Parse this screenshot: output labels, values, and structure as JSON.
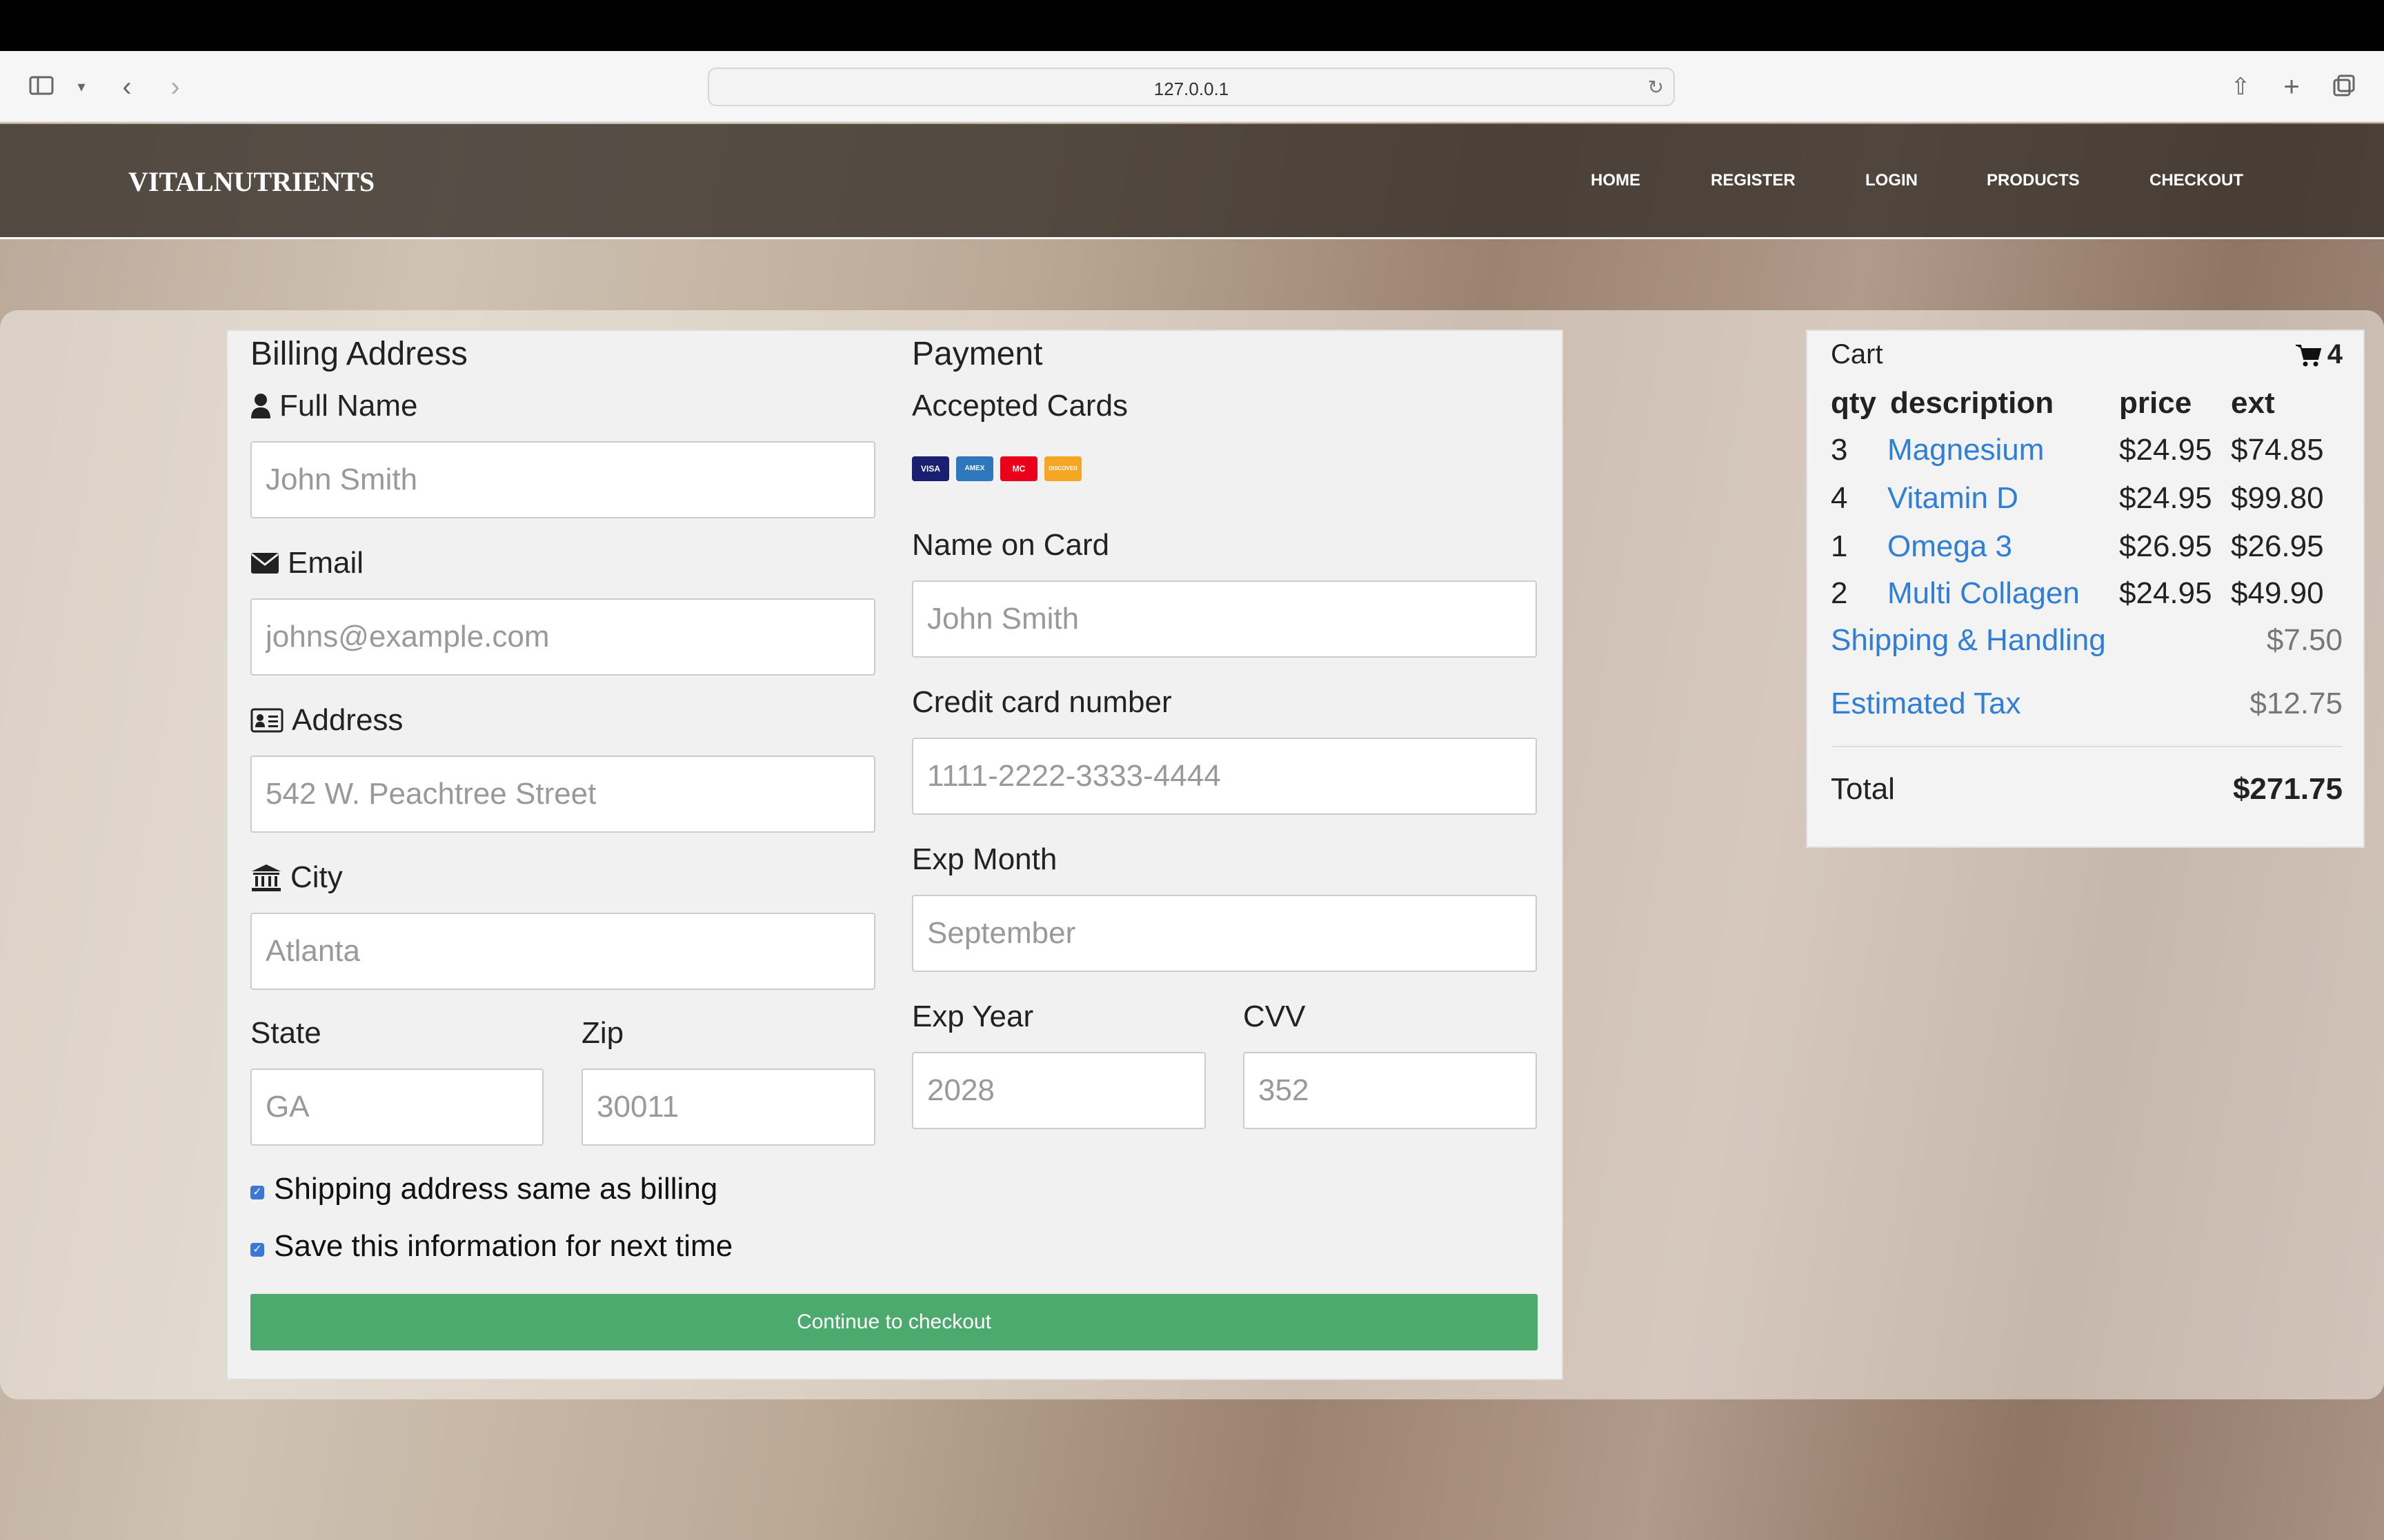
{
  "browser": {
    "url": "127.0.0.1"
  },
  "nav": {
    "brand": "VITALNUTRIENTS",
    "links": [
      "HOME",
      "REGISTER",
      "LOGIN",
      "PRODUCTS",
      "CHECKOUT"
    ]
  },
  "billing": {
    "title": "Billing Address",
    "full_name": {
      "label": "Full Name",
      "placeholder": "John Smith"
    },
    "email": {
      "label": "Email",
      "placeholder": "johns@example.com"
    },
    "address": {
      "label": "Address",
      "placeholder": "542 W. Peachtree Street"
    },
    "city": {
      "label": "City",
      "placeholder": "Atlanta"
    },
    "state": {
      "label": "State",
      "placeholder": "GA"
    },
    "zip": {
      "label": "Zip",
      "placeholder": "30011"
    }
  },
  "payment": {
    "title": "Payment",
    "accepted_label": "Accepted Cards",
    "cards": [
      "VISA",
      "AMEX",
      "MC",
      "DISCOVER"
    ],
    "name_on_card": {
      "label": "Name on Card",
      "placeholder": "John Smith"
    },
    "card_number": {
      "label": "Credit card number",
      "placeholder": "1111-2222-3333-4444"
    },
    "exp_month": {
      "label": "Exp Month",
      "placeholder": "September"
    },
    "exp_year": {
      "label": "Exp Year",
      "placeholder": "2028"
    },
    "cvv": {
      "label": "CVV",
      "placeholder": "352"
    }
  },
  "options": {
    "same_address": "Shipping address same as billing",
    "save_info": "Save this information for next time"
  },
  "checkout_button": "Continue to checkout",
  "cart": {
    "title": "Cart",
    "count": "4",
    "headers": {
      "qty": "qty",
      "description": "description",
      "price": "price",
      "ext": "ext"
    },
    "items": [
      {
        "qty": "3",
        "description": "Magnesium",
        "price": "$24.95",
        "ext": "$74.85"
      },
      {
        "qty": "4",
        "description": "Vitamin D",
        "price": "$24.95",
        "ext": "$99.80"
      },
      {
        "qty": "1",
        "description": "Omega 3",
        "price": "$26.95",
        "ext": "$26.95"
      },
      {
        "qty": "2",
        "description": "Multi Collagen",
        "price": "$24.95",
        "ext": "$49.90"
      }
    ],
    "shipping": {
      "label": "Shipping & Handling",
      "value": "$7.50"
    },
    "tax": {
      "label": "Estimated Tax",
      "value": "$12.75"
    },
    "total": {
      "label": "Total",
      "value": "$271.75"
    }
  },
  "colors": {
    "accent": "#4caa6e",
    "link": "#2f7ed8",
    "nav_bg": "#342e28"
  }
}
